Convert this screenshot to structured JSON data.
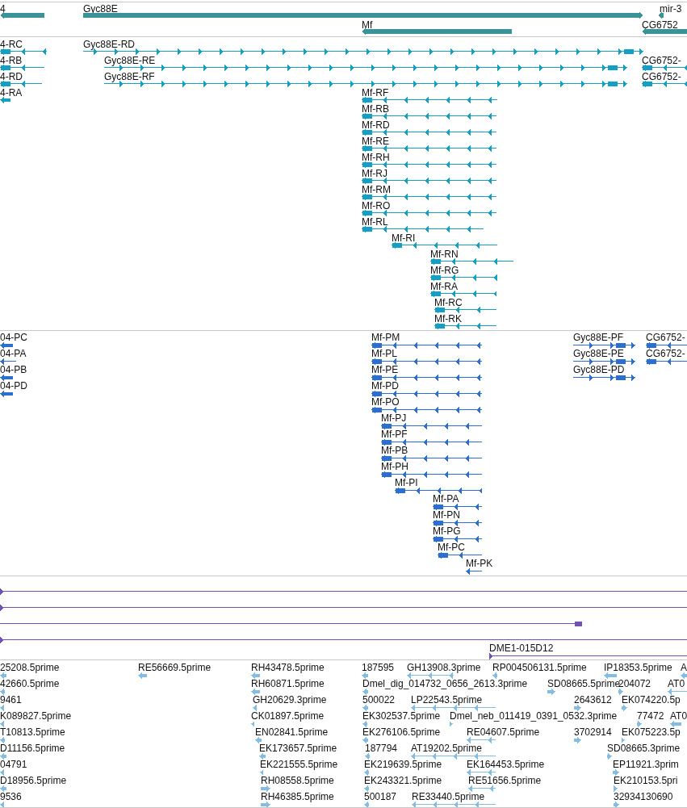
{
  "tracks": [
    {
      "kind": "gene",
      "color": "#3a9399",
      "features": [
        {
          "label": "4",
          "reverse": true
        },
        {
          "label": "Gyc88E",
          "reverse": false
        },
        {
          "label": "mir-3",
          "reverse": true
        },
        {
          "label": "Mf",
          "reverse": true
        },
        {
          "label": "CG6752",
          "reverse": true
        }
      ]
    },
    {
      "kind": "transcript",
      "color": "#14a0c4",
      "features": [
        {
          "label": "4-RC",
          "reverse": true
        },
        {
          "label": "Gyc88E-RD",
          "reverse": false
        },
        {
          "label": "4-RB",
          "reverse": true
        },
        {
          "label": "Gyc88E-RE",
          "reverse": false
        },
        {
          "label": "CG6752-",
          "reverse": true
        },
        {
          "label": "4-RD",
          "reverse": true
        },
        {
          "label": "Gyc88E-RF",
          "reverse": false
        },
        {
          "label": "CG6752-",
          "reverse": true
        },
        {
          "label": "4-RA",
          "reverse": true
        },
        {
          "label": "Mf-RF",
          "reverse": true
        },
        {
          "label": "Mf-RB",
          "reverse": true
        },
        {
          "label": "Mf-RD",
          "reverse": true
        },
        {
          "label": "Mf-RE",
          "reverse": true
        },
        {
          "label": "Mf-RH",
          "reverse": true
        },
        {
          "label": "Mf-RJ",
          "reverse": true
        },
        {
          "label": "Mf-RM",
          "reverse": true
        },
        {
          "label": "Mf-RO",
          "reverse": true
        },
        {
          "label": "Mf-RL",
          "reverse": true
        },
        {
          "label": "Mf-RI",
          "reverse": true
        },
        {
          "label": "Mf-RN",
          "reverse": true
        },
        {
          "label": "Mf-RG",
          "reverse": true
        },
        {
          "label": "Mf-RA",
          "reverse": true
        },
        {
          "label": "Mf-RC",
          "reverse": true
        },
        {
          "label": "Mf-RK",
          "reverse": true
        }
      ]
    },
    {
      "kind": "transcript",
      "color": "#2b6fd4",
      "features": [
        {
          "label": "04-PC",
          "reverse": true
        },
        {
          "label": "Mf-PM",
          "reverse": true
        },
        {
          "label": "Gyc88E-PF",
          "reverse": false
        },
        {
          "label": "CG6752-",
          "reverse": true
        },
        {
          "label": "04-PA",
          "reverse": true
        },
        {
          "label": "Mf-PL",
          "reverse": true
        },
        {
          "label": "Gyc88E-PE",
          "reverse": false
        },
        {
          "label": "CG6752-",
          "reverse": true
        },
        {
          "label": "04-PB",
          "reverse": true
        },
        {
          "label": "Mf-PE",
          "reverse": true
        },
        {
          "label": "Gyc88E-PD",
          "reverse": false
        },
        {
          "label": "04-PD",
          "reverse": true
        },
        {
          "label": "Mf-PD",
          "reverse": true
        },
        {
          "label": "Mf-PO",
          "reverse": true
        },
        {
          "label": "Mf-PJ",
          "reverse": true
        },
        {
          "label": "Mf-PF",
          "reverse": true
        },
        {
          "label": "Mf-PB",
          "reverse": true
        },
        {
          "label": "Mf-PH",
          "reverse": true
        },
        {
          "label": "Mf-PI",
          "reverse": true
        },
        {
          "label": "Mf-PA",
          "reverse": true
        },
        {
          "label": "Mf-PN",
          "reverse": true
        },
        {
          "label": "Mf-PG",
          "reverse": true
        },
        {
          "label": "Mf-PC",
          "reverse": true
        },
        {
          "label": "Mf-PK",
          "reverse": true
        }
      ]
    },
    {
      "kind": "alignment",
      "color": "#7052b6",
      "features": [
        {
          "reverse": false
        },
        {
          "reverse": false
        },
        {
          "reverse": true
        },
        {
          "reverse": false
        },
        {
          "label": "DME1-015D12",
          "reverse": false
        }
      ]
    },
    {
      "kind": "est",
      "color": "#84bde3",
      "features": [
        {
          "label": "25208.5prime",
          "reverse": true
        },
        {
          "label": "RE56669.5prime",
          "reverse": true
        },
        {
          "label": "RH43478.5prime",
          "reverse": true
        },
        {
          "label": "187595",
          "reverse": true
        },
        {
          "label": "GH13908.3prime",
          "reverse": true
        },
        {
          "label": "RP004506131.5prime",
          "reverse": true
        },
        {
          "label": "IP18353.5prime",
          "reverse": true
        },
        {
          "label": "A",
          "reverse": true
        },
        {
          "label": "42660.5prime",
          "reverse": true
        },
        {
          "label": "RH60871.5prime",
          "reverse": true
        },
        {
          "label": "Dmel_dig_014732_0656_2613.3prime",
          "reverse": true
        },
        {
          "label": "SD08665.5prime",
          "reverse": false
        },
        {
          "label": "204072",
          "reverse": false
        },
        {
          "label": "AT0",
          "reverse": true
        },
        {
          "label": "9461",
          "reverse": true
        },
        {
          "label": "GH20629.3prime",
          "reverse": true
        },
        {
          "label": "500022",
          "reverse": true
        },
        {
          "label": "LP22543.5prime",
          "reverse": true
        },
        {
          "label": "2643612",
          "reverse": false
        },
        {
          "label": "EK074220.5p",
          "reverse": false
        },
        {
          "label": "K089827.5prime",
          "reverse": true
        },
        {
          "label": "CK01897.5prime",
          "reverse": true
        },
        {
          "label": "EK302537.5prime",
          "reverse": true
        },
        {
          "label": "Dmel_neb_011419_0391_0532.3prime",
          "reverse": false
        },
        {
          "label": "77472",
          "reverse": false
        },
        {
          "label": "AT0",
          "reverse": true
        },
        {
          "label": "T10813.5prime",
          "reverse": true
        },
        {
          "label": "EN02841.5prime",
          "reverse": true
        },
        {
          "label": "EK276106.5prime",
          "reverse": true
        },
        {
          "label": "RE04607.5prime",
          "reverse": true
        },
        {
          "label": "3702914",
          "reverse": false
        },
        {
          "label": "EK075223.5p",
          "reverse": false
        },
        {
          "label": "D11156.5prime",
          "reverse": true
        },
        {
          "label": "EK173657.5prime",
          "reverse": true
        },
        {
          "label": "187794",
          "reverse": true
        },
        {
          "label": "AT19202.5prime",
          "reverse": true
        },
        {
          "label": "SD08665.3prime",
          "reverse": false
        },
        {
          "label": "04791",
          "reverse": true
        },
        {
          "label": "EK221555.5prime",
          "reverse": true
        },
        {
          "label": "EK219639.5prime",
          "reverse": true
        },
        {
          "label": "EK164453.5prime",
          "reverse": true
        },
        {
          "label": "EP11921.3prim",
          "reverse": false
        },
        {
          "label": "D18956.5prime",
          "reverse": true
        },
        {
          "label": "RH08558.5prime",
          "reverse": false
        },
        {
          "label": "EK243321.5prime",
          "reverse": true
        },
        {
          "label": "RE51656.5prime",
          "reverse": true
        },
        {
          "label": "EK210153.5pri",
          "reverse": false
        },
        {
          "label": "9536",
          "reverse": true
        },
        {
          "label": "RH46385.5prime",
          "reverse": false
        },
        {
          "label": "500187",
          "reverse": true
        },
        {
          "label": "RE33440.5prime",
          "reverse": true
        },
        {
          "label": "32934130690",
          "reverse": false
        }
      ]
    }
  ]
}
